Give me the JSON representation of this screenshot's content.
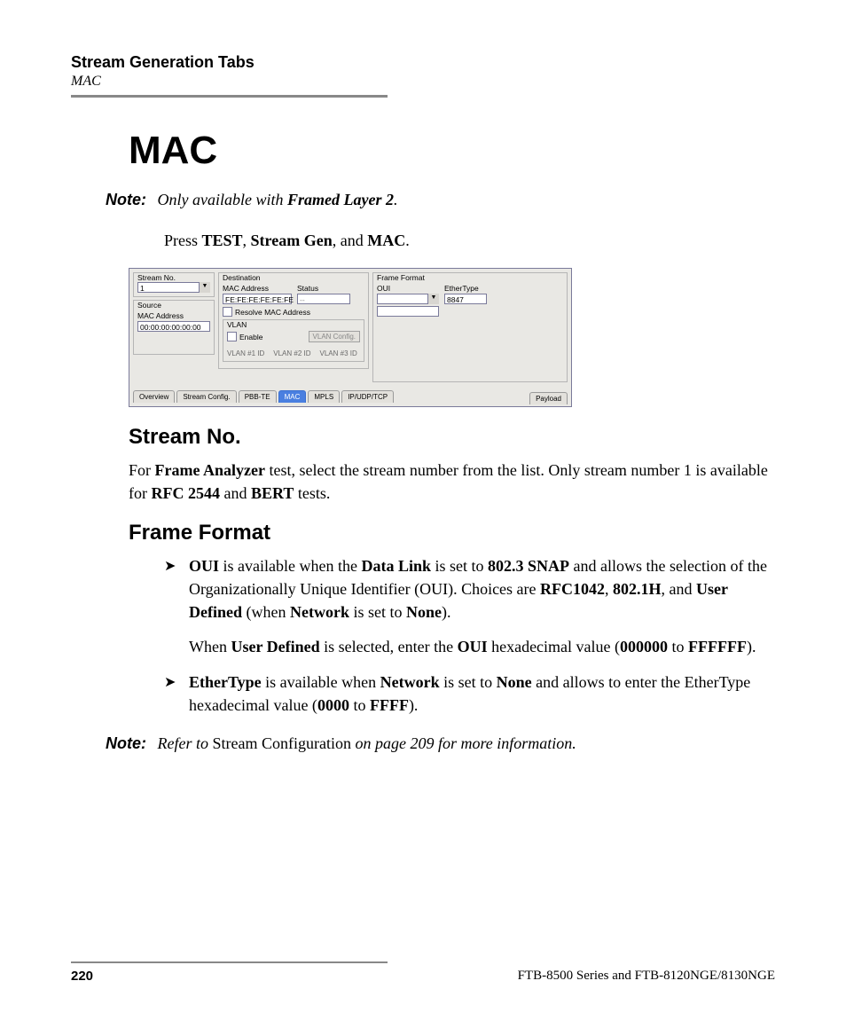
{
  "header": {
    "chapter": "Stream Generation Tabs",
    "subsection": "MAC"
  },
  "title": "MAC",
  "note1": {
    "label": "Note:",
    "text_before": "Only available with ",
    "bold": "Framed Layer 2",
    "text_after": "."
  },
  "press_line": {
    "prefix": "Press ",
    "b1": "TEST",
    "s1": ", ",
    "b2": "Stream Gen",
    "s2": ", and ",
    "b3": "MAC",
    "suffix": "."
  },
  "ui": {
    "stream_no": {
      "legend": "Stream No.",
      "value": "1"
    },
    "source": {
      "legend": "Source",
      "mac_label": "MAC Address",
      "mac_value": "00:00:00:00:00:00"
    },
    "destination": {
      "legend": "Destination",
      "mac_label": "MAC Address",
      "mac_value": "FE:FE:FE:FE:FE:FE",
      "status_label": "Status",
      "status_value": "--",
      "resolve": "Resolve MAC Address"
    },
    "vlan": {
      "legend": "VLAN",
      "enable": "Enable",
      "config_btn": "VLAN Config.",
      "id1": "VLAN #1 ID",
      "id2": "VLAN #2 ID",
      "id3": "VLAN #3 ID"
    },
    "frame_format": {
      "legend": "Frame Format",
      "oui_label": "OUI",
      "ethertype_label": "EtherType",
      "ethertype_value": "8847"
    },
    "tabs": {
      "overview": "Overview",
      "stream_config": "Stream Config.",
      "pbb_te": "PBB-TE",
      "mac": "MAC",
      "mpls": "MPLS",
      "ip": "IP/UDP/TCP",
      "payload": "Payload"
    }
  },
  "section_stream_no": {
    "heading": "Stream No.",
    "p_prefix": "For ",
    "p_b1": "Frame Analyzer",
    "p_mid": " test, select the stream number from the list. Only stream number 1 is available for ",
    "p_b2": "RFC 2544",
    "p_and": " and ",
    "p_b3": "BERT",
    "p_suffix": " tests."
  },
  "section_frame_format": {
    "heading": "Frame Format",
    "li1": {
      "b1": "OUI",
      "t1": " is available when the ",
      "b2": "Data Link",
      "t2": " is set to ",
      "b3": "802.3 SNAP",
      "t3": " and allows the selection of the Organizationally Unique Identifier (OUI). Choices are ",
      "b4": "RFC1042",
      "t4": ", ",
      "b5": "802.1H",
      "t5": ", and ",
      "b6": "User Defined",
      "t6": " (when ",
      "b7": "Network",
      "t7": " is set to ",
      "b8": "None",
      "t8": ").",
      "p2_t1": "When ",
      "p2_b1": "User Defined",
      "p2_t2": " is selected, enter the ",
      "p2_b2": "OUI",
      "p2_t3": " hexadecimal value (",
      "p2_b3": "000000",
      "p2_t4": " to ",
      "p2_b4": "FFFFFF",
      "p2_t5": ")."
    },
    "li2": {
      "b1": "EtherType",
      "t1": " is available when ",
      "b2": "Network",
      "t2": " is set to ",
      "b3": "None",
      "t3": " and allows to enter the EtherType hexadecimal value (",
      "b4": "0000",
      "t4": " to ",
      "b5": "FFFF",
      "t5": ")."
    }
  },
  "note2": {
    "label": "Note:",
    "t1": "Refer to ",
    "roman": "Stream Configuration",
    "t2": " on page 209 for more information."
  },
  "footer": {
    "page": "220",
    "product": "FTB-8500 Series and FTB-8120NGE/8130NGE"
  }
}
